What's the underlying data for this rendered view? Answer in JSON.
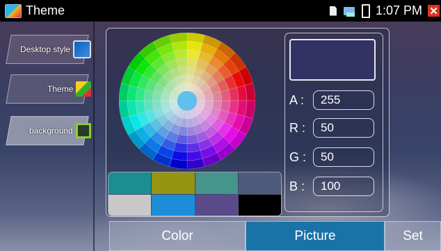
{
  "app": {
    "title": "Theme"
  },
  "status_bar": {
    "time": "1:07 PM"
  },
  "sidebar": {
    "items": [
      {
        "label": "Desktop style",
        "icon": "desktop-style-icon",
        "active": false
      },
      {
        "label": "Theme",
        "icon": "theme-icon",
        "active": false
      },
      {
        "label": "background",
        "icon": "background-icon",
        "active": true
      }
    ]
  },
  "color": {
    "preview_hex": "#323264",
    "fields": [
      {
        "key": "A :",
        "value": "255"
      },
      {
        "key": "R :",
        "value": "50"
      },
      {
        "key": "G :",
        "value": "50"
      },
      {
        "key": "B :",
        "value": "100"
      }
    ],
    "palette": [
      "#1a8f91",
      "#959413",
      "#45958d",
      "#4c5b79",
      "#c8c8c8",
      "#1a8fd8",
      "#5a4a8a",
      "#000000"
    ]
  },
  "tabs": [
    {
      "label": "Color",
      "active": false
    },
    {
      "label": "Picture",
      "active": true
    },
    {
      "label": "Set",
      "active": false
    }
  ]
}
